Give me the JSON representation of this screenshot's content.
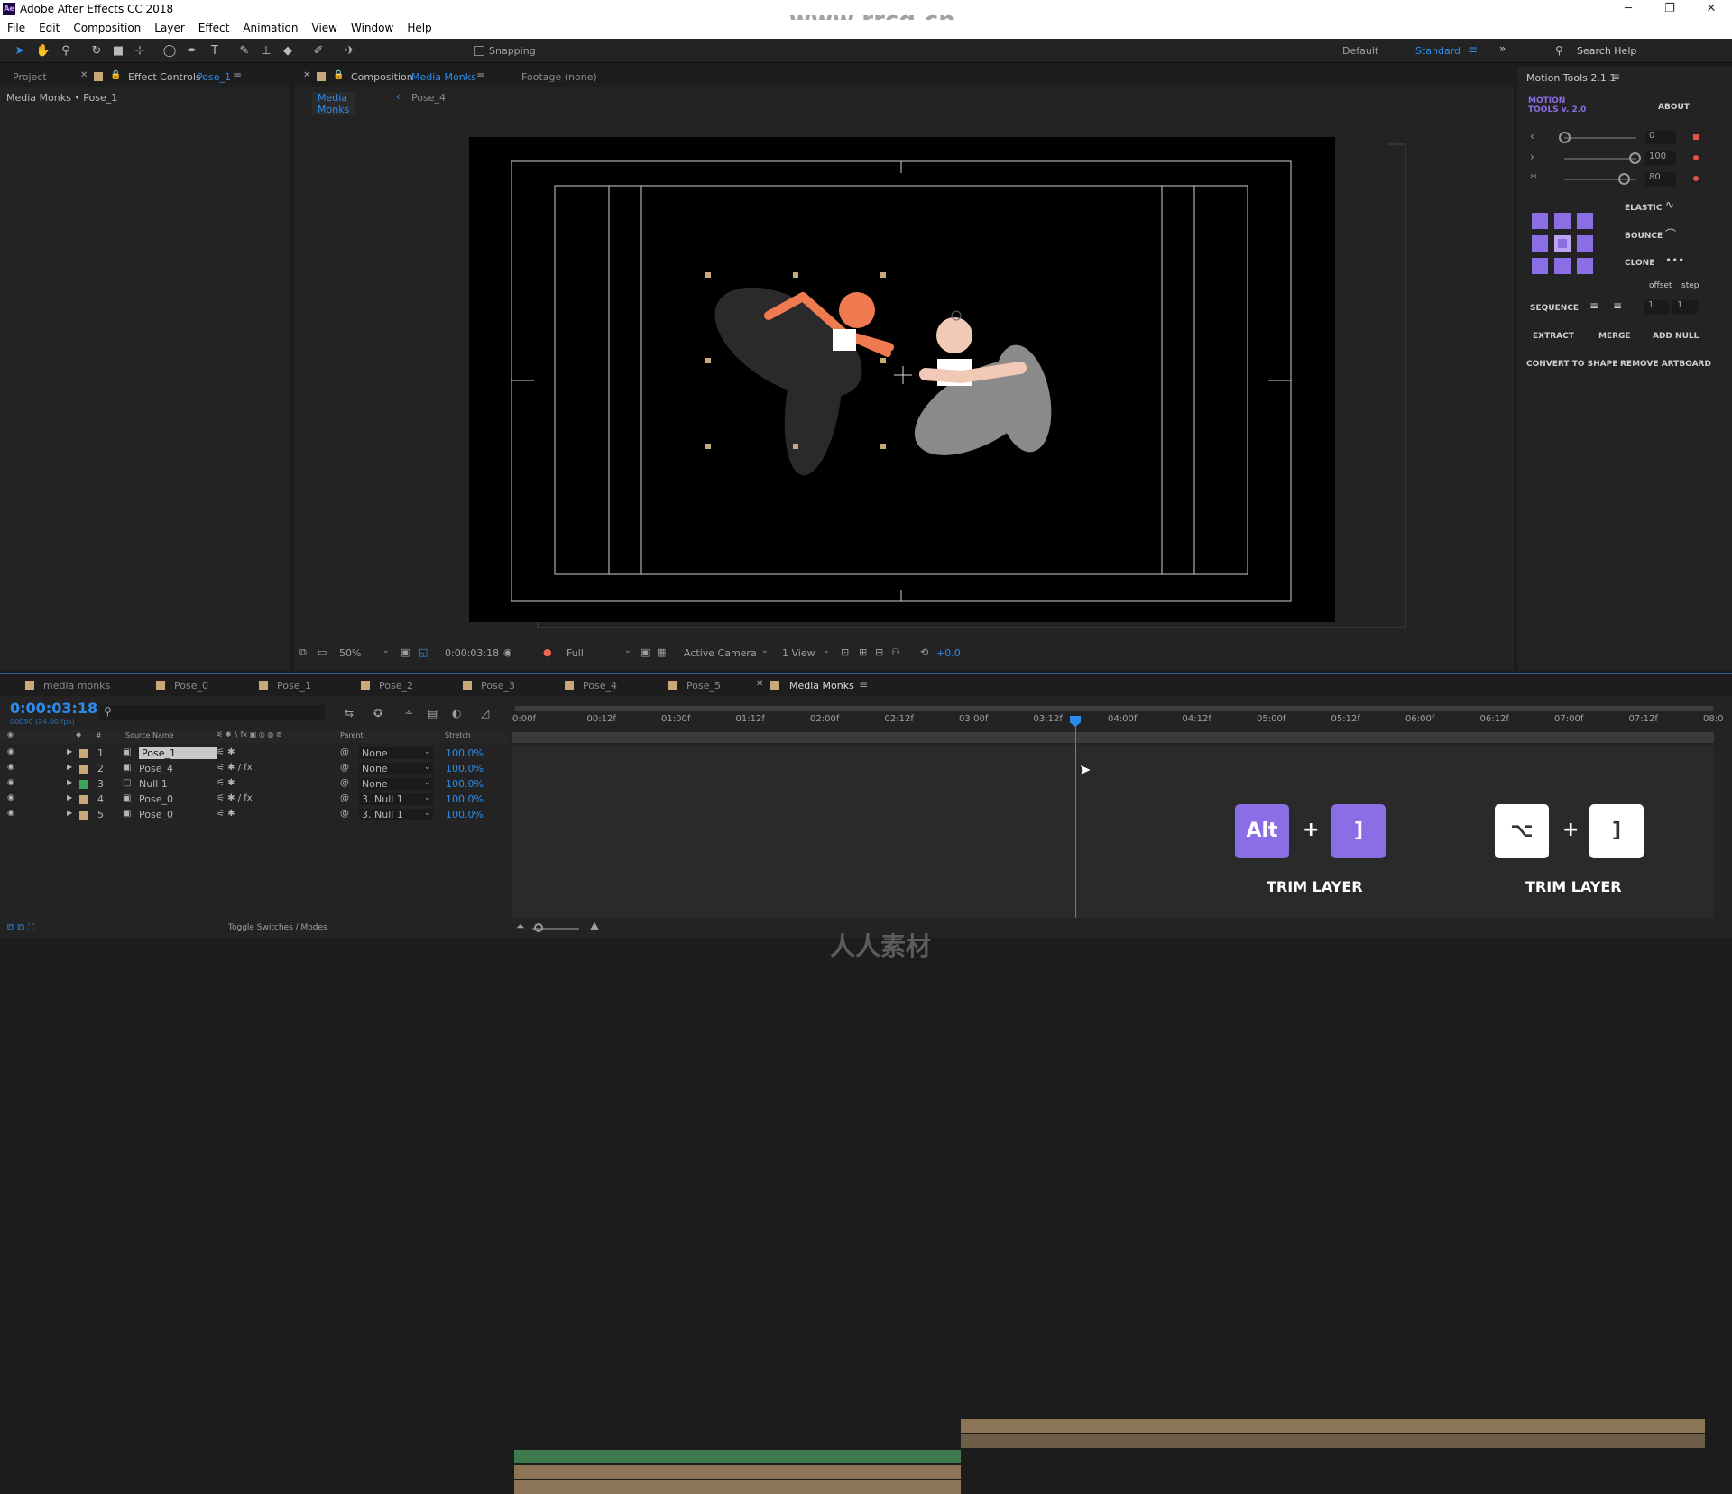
{
  "window": {
    "title": "Adobe After Effects CC 2018",
    "watermark_top": "www.rrcg.cn",
    "watermark_bottom": "人人素材"
  },
  "menu": [
    "File",
    "Edit",
    "Composition",
    "Layer",
    "Effect",
    "Animation",
    "View",
    "Window",
    "Help"
  ],
  "toolbar": {
    "snapping": "Snapping",
    "workspaces": [
      "Default",
      "Standard"
    ],
    "search": "Search Help"
  },
  "left_panel": {
    "tab_project": "Project",
    "tab_effect_prefix": "Effect Controls",
    "tab_effect_layer": "Pose_1",
    "breadcrumb": "Media Monks • Pose_1"
  },
  "comp_panel": {
    "tab_prefix": "Composition",
    "tab_name": "Media Monks",
    "footage": "Footage (none)",
    "crumb1": "Media Monks",
    "crumb2": "Pose_4"
  },
  "viewer_footer": {
    "zoom": "50%",
    "time": "0:00:03:18",
    "resolution": "Full",
    "camera": "Active Camera",
    "view": "1 View",
    "exposure": "+0.0"
  },
  "motion_tools": {
    "title": "Motion Tools 2.1.1",
    "logo1": "MOTION",
    "logo2": "TOOLS v. 2.0",
    "about": "ABOUT",
    "sliders": [
      "0",
      "100",
      "80"
    ],
    "elastic": "ELASTIC",
    "bounce": "BOUNCE",
    "clone": "CLONE",
    "offset": "offset",
    "step": "step",
    "sequence": "SEQUENCE",
    "seq_vals": [
      "1",
      "1"
    ],
    "extract": "EXTRACT",
    "merge": "MERGE",
    "add_null": "ADD NULL",
    "convert": "CONVERT TO SHAPE",
    "remove_artboard": "REMOVE ARTBOARD",
    "accent": "#8b6ee6"
  },
  "timeline": {
    "tabs": [
      "media monks",
      "Pose_0",
      "Pose_1",
      "Pose_2",
      "Pose_3",
      "Pose_4",
      "Pose_5",
      "Media Monks"
    ],
    "timecode": "0:00:03:18",
    "fps": "00090 (24.00 fps)",
    "col_source": "Source Name",
    "col_parent": "Parent",
    "col_stretch": "Stretch",
    "ruler": [
      "0:00f",
      "00:12f",
      "01:00f",
      "01:12f",
      "02:00f",
      "02:12f",
      "03:00f",
      "03:12f",
      "04:00f",
      "04:12f",
      "05:00f",
      "05:12f",
      "06:00f",
      "06:12f",
      "07:00f",
      "07:12f",
      "08:0"
    ],
    "layers": [
      {
        "num": "1",
        "name": "Pose_1",
        "parent": "None",
        "stretch": "100.0%"
      },
      {
        "num": "2",
        "name": "Pose_4",
        "parent": "None",
        "stretch": "100.0%"
      },
      {
        "num": "3",
        "name": "Null 1",
        "parent": "None",
        "stretch": "100.0%"
      },
      {
        "num": "4",
        "name": "Pose_0",
        "parent": "3. Null 1",
        "stretch": "100.0%"
      },
      {
        "num": "5",
        "name": "Pose_0",
        "parent": "3. Null 1",
        "stretch": "100.0%"
      }
    ],
    "toggle": "Toggle Switches / Modes"
  },
  "overlay": {
    "win_key": "Alt",
    "mac_key": "⌥",
    "plus": "+",
    "bracket": "]",
    "label": "TRIM LAYER"
  }
}
